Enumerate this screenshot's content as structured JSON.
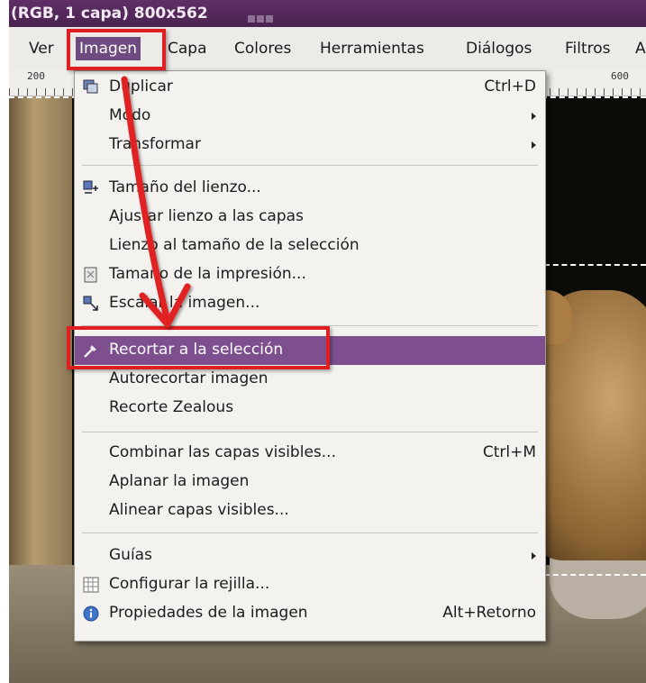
{
  "window": {
    "title": "(RGB, 1 capa) 800x562"
  },
  "menubar": {
    "items": [
      "Ver",
      "Imagen",
      "Capa",
      "Colores",
      "Herramientas",
      "Diálogos",
      "Filtros",
      "A"
    ],
    "active": "Imagen"
  },
  "ruler": {
    "labels": [
      "200",
      "600"
    ]
  },
  "menu": {
    "items": [
      {
        "label": "Duplicar",
        "shortcut": "Ctrl+D",
        "icon": "duplicate-icon"
      },
      {
        "label": "Modo",
        "submenu": true
      },
      {
        "label": "Transformar",
        "submenu": true
      },
      {
        "label": "Tamaño del lienzo...",
        "icon": "canvas-size-icon"
      },
      {
        "label": "Ajustar lienzo a las capas"
      },
      {
        "label": "Lienzo al tamaño de la selección"
      },
      {
        "label": "Tamaño de la impresión...",
        "icon": "print-size-icon"
      },
      {
        "label": "Escalar la imagen...",
        "icon": "scale-icon"
      },
      {
        "label": "Recortar a la selección",
        "icon": "crop-icon",
        "highlighted": true
      },
      {
        "label": "Autorecortar imagen"
      },
      {
        "label": "Recorte Zealous"
      },
      {
        "label": "Combinar las capas visibles...",
        "shortcut": "Ctrl+M"
      },
      {
        "label": "Aplanar la imagen"
      },
      {
        "label": "Alinear capas visibles..."
      },
      {
        "label": "Guías",
        "submenu": true
      },
      {
        "label": "Configurar la rejilla...",
        "icon": "grid-icon"
      },
      {
        "label": "Propiedades de la imagen",
        "shortcut": "Alt+Retorno",
        "icon": "info-icon"
      }
    ]
  },
  "colors": {
    "highlight": "#7d4f8e",
    "annotation": "#e02020"
  }
}
